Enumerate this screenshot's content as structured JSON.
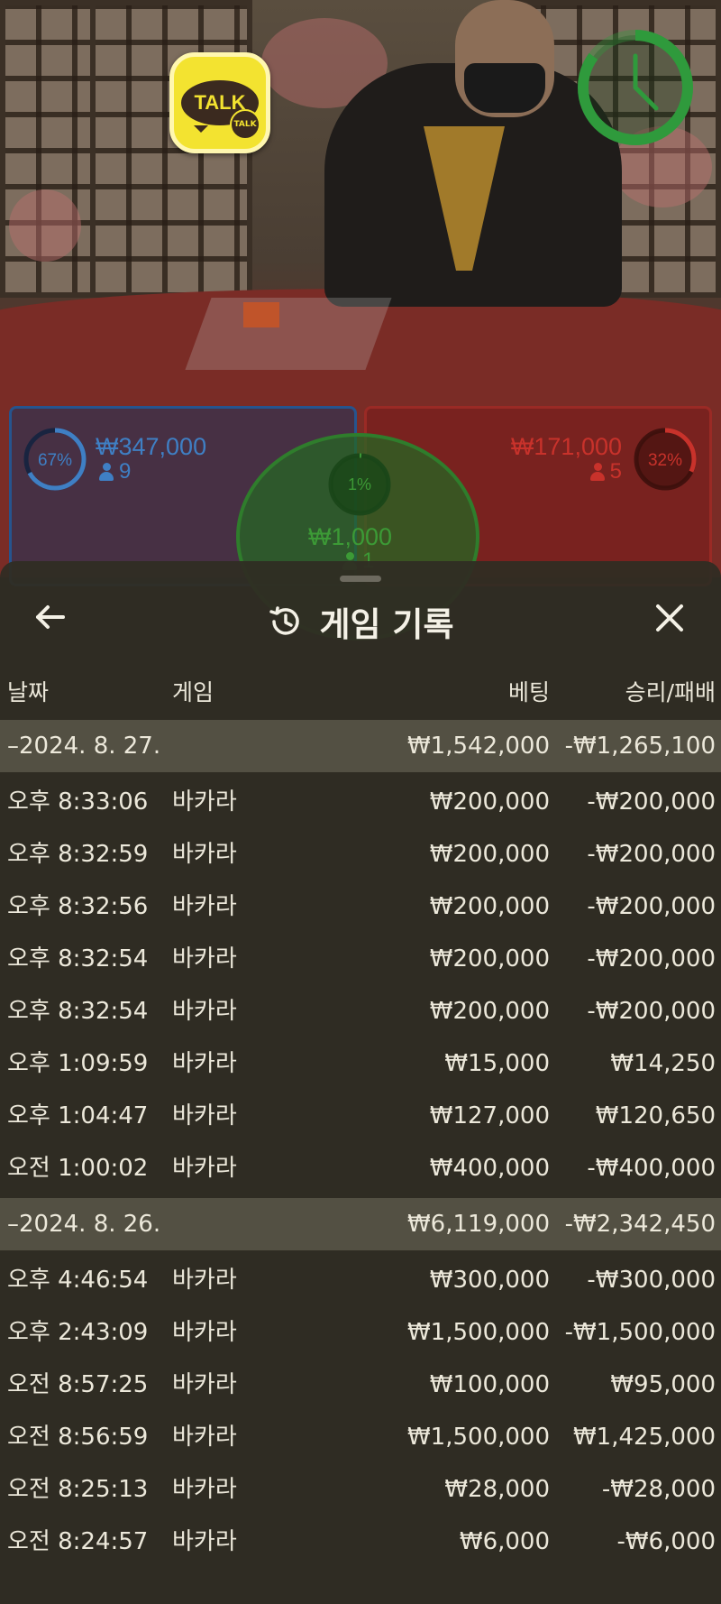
{
  "overlay": {
    "talk_top": "TALK",
    "talk_mini": "TALK",
    "player": {
      "pct": "67%",
      "pct_value": 0.67,
      "amount": "₩347,000",
      "count": "9"
    },
    "banker": {
      "pct": "32%",
      "pct_value": 0.32,
      "amount": "₩171,000",
      "count": "5"
    },
    "tie": {
      "pct": "1%",
      "pct_value": 0.01,
      "amount": "₩1,000",
      "count": "1"
    },
    "colors": {
      "player": "#3f7fc4",
      "banker": "#c8322b",
      "tie": "#3c9a36",
      "timer": "#2f9a3c"
    }
  },
  "sheet": {
    "title": "게임 기록",
    "history_icon": "history-icon",
    "back_icon": "arrow-left-icon",
    "close_icon": "close-icon",
    "columns": {
      "date": "날짜",
      "game": "게임",
      "bet": "베팅",
      "result": "승리/패배"
    },
    "days": [
      {
        "date": "–2024. 8. 27.",
        "bet_total": "₩1,542,000",
        "result_total": "-₩1,265,100",
        "rows": [
          {
            "time": "오후 8:33:06",
            "game": "바카라",
            "bet": "₩200,000",
            "result": "-₩200,000"
          },
          {
            "time": "오후 8:32:59",
            "game": "바카라",
            "bet": "₩200,000",
            "result": "-₩200,000"
          },
          {
            "time": "오후 8:32:56",
            "game": "바카라",
            "bet": "₩200,000",
            "result": "-₩200,000"
          },
          {
            "time": "오후 8:32:54",
            "game": "바카라",
            "bet": "₩200,000",
            "result": "-₩200,000"
          },
          {
            "time": "오후 8:32:54",
            "game": "바카라",
            "bet": "₩200,000",
            "result": "-₩200,000"
          },
          {
            "time": "오후 1:09:59",
            "game": "바카라",
            "bet": "₩15,000",
            "result": "₩14,250"
          },
          {
            "time": "오후 1:04:47",
            "game": "바카라",
            "bet": "₩127,000",
            "result": "₩120,650"
          },
          {
            "time": "오전 1:00:02",
            "game": "바카라",
            "bet": "₩400,000",
            "result": "-₩400,000"
          }
        ]
      },
      {
        "date": "–2024. 8. 26.",
        "bet_total": "₩6,119,000",
        "result_total": "-₩2,342,450",
        "rows": [
          {
            "time": "오후 4:46:54",
            "game": "바카라",
            "bet": "₩300,000",
            "result": "-₩300,000"
          },
          {
            "time": "오후 2:43:09",
            "game": "바카라",
            "bet": "₩1,500,000",
            "result": "-₩1,500,000"
          },
          {
            "time": "오전 8:57:25",
            "game": "바카라",
            "bet": "₩100,000",
            "result": "₩95,000"
          },
          {
            "time": "오전 8:56:59",
            "game": "바카라",
            "bet": "₩1,500,000",
            "result": "₩1,425,000"
          },
          {
            "time": "오전 8:25:13",
            "game": "바카라",
            "bet": "₩28,000",
            "result": "-₩28,000"
          },
          {
            "time": "오전 8:24:57",
            "game": "바카라",
            "bet": "₩6,000",
            "result": "-₩6,000"
          }
        ]
      }
    ]
  }
}
